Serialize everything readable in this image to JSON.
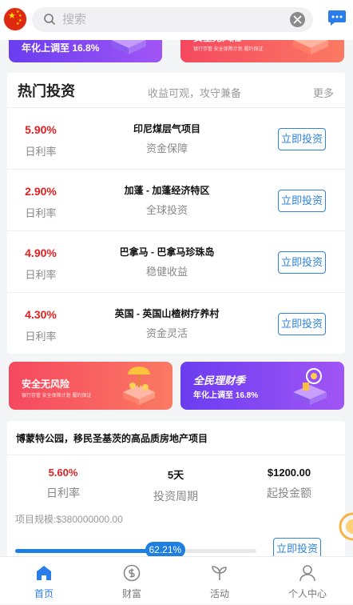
{
  "header": {
    "search_placeholder": "搜索",
    "flag_icon": "china-flag-icon",
    "message_icon": "message-icon"
  },
  "top_banners": [
    {
      "title": "年化上调至 16.8%"
    },
    {
      "title": "安全无风险",
      "subtitle": "银行存管 安全保障计划 履约保证"
    }
  ],
  "hot": {
    "title": "热门投资",
    "subtitle": "收益可观，攻守兼备",
    "more": "更多",
    "rate_label": "日利率",
    "button_label": "立即投资",
    "items": [
      {
        "rate": "5.90%",
        "name": "印尼煤层气项目",
        "tag": "资金保障"
      },
      {
        "rate": "2.90%",
        "name": "加蓬 - 加蓬经济特区",
        "tag": "全球投资"
      },
      {
        "rate": "4.90%",
        "name": "巴拿马 - 巴拿马珍珠岛",
        "tag": "稳健收益"
      },
      {
        "rate": "4.30%",
        "name": "英国 - 英国山楂树疗养村",
        "tag": "资金灵活"
      }
    ]
  },
  "mid_banners": [
    {
      "title": "安全无风险",
      "subtitle": "银行存管 安全保障计划 履约保证"
    },
    {
      "title": "全民理财季",
      "subtitle": "年化上调至 16.8%"
    }
  ],
  "featured": {
    "title": "博蒙特公园，移民圣基茨的高品质房地产项目",
    "rate": "5.60%",
    "rate_label": "日利率",
    "period": "5天",
    "period_label": "投资周期",
    "min_amount": "$1200.00",
    "min_amount_label": "起投金额",
    "scale": "项目规模:$380000000.00",
    "progress": 62.21,
    "progress_text": "62.21%",
    "button_label": "立即投资"
  },
  "tabbar": [
    {
      "label": "首页",
      "icon": "home-icon",
      "active": true
    },
    {
      "label": "财富",
      "icon": "wealth-icon",
      "active": false
    },
    {
      "label": "活动",
      "icon": "sprout-icon",
      "active": false
    },
    {
      "label": "个人中心",
      "icon": "user-icon",
      "active": false
    }
  ],
  "colors": {
    "accent": "#2b7de9",
    "rate_red": "#e02020",
    "banner_red": "#f5485f",
    "banner_purple": "#7a44f2"
  }
}
